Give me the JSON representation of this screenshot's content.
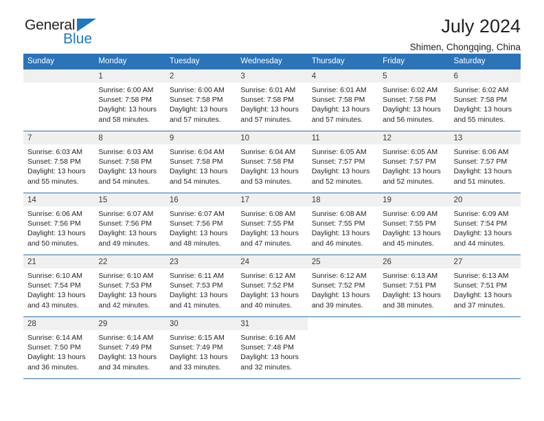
{
  "brand": {
    "name_part1": "General",
    "name_part2": "Blue",
    "triangle_color": "#1f78c1",
    "accent_color": "#2b74b8"
  },
  "header": {
    "title": "July 2024",
    "subtitle": "Shimen, Chongqing, China"
  },
  "weekday_headers": [
    "Sunday",
    "Monday",
    "Tuesday",
    "Wednesday",
    "Thursday",
    "Friday",
    "Saturday"
  ],
  "weeks": [
    [
      {
        "day": "",
        "lines": []
      },
      {
        "day": "1",
        "lines": [
          "Sunrise: 6:00 AM",
          "Sunset: 7:58 PM",
          "Daylight: 13 hours",
          "and 58 minutes."
        ]
      },
      {
        "day": "2",
        "lines": [
          "Sunrise: 6:00 AM",
          "Sunset: 7:58 PM",
          "Daylight: 13 hours",
          "and 57 minutes."
        ]
      },
      {
        "day": "3",
        "lines": [
          "Sunrise: 6:01 AM",
          "Sunset: 7:58 PM",
          "Daylight: 13 hours",
          "and 57 minutes."
        ]
      },
      {
        "day": "4",
        "lines": [
          "Sunrise: 6:01 AM",
          "Sunset: 7:58 PM",
          "Daylight: 13 hours",
          "and 57 minutes."
        ]
      },
      {
        "day": "5",
        "lines": [
          "Sunrise: 6:02 AM",
          "Sunset: 7:58 PM",
          "Daylight: 13 hours",
          "and 56 minutes."
        ]
      },
      {
        "day": "6",
        "lines": [
          "Sunrise: 6:02 AM",
          "Sunset: 7:58 PM",
          "Daylight: 13 hours",
          "and 55 minutes."
        ]
      }
    ],
    [
      {
        "day": "7",
        "lines": [
          "Sunrise: 6:03 AM",
          "Sunset: 7:58 PM",
          "Daylight: 13 hours",
          "and 55 minutes."
        ]
      },
      {
        "day": "8",
        "lines": [
          "Sunrise: 6:03 AM",
          "Sunset: 7:58 PM",
          "Daylight: 13 hours",
          "and 54 minutes."
        ]
      },
      {
        "day": "9",
        "lines": [
          "Sunrise: 6:04 AM",
          "Sunset: 7:58 PM",
          "Daylight: 13 hours",
          "and 54 minutes."
        ]
      },
      {
        "day": "10",
        "lines": [
          "Sunrise: 6:04 AM",
          "Sunset: 7:58 PM",
          "Daylight: 13 hours",
          "and 53 minutes."
        ]
      },
      {
        "day": "11",
        "lines": [
          "Sunrise: 6:05 AM",
          "Sunset: 7:57 PM",
          "Daylight: 13 hours",
          "and 52 minutes."
        ]
      },
      {
        "day": "12",
        "lines": [
          "Sunrise: 6:05 AM",
          "Sunset: 7:57 PM",
          "Daylight: 13 hours",
          "and 52 minutes."
        ]
      },
      {
        "day": "13",
        "lines": [
          "Sunrise: 6:06 AM",
          "Sunset: 7:57 PM",
          "Daylight: 13 hours",
          "and 51 minutes."
        ]
      }
    ],
    [
      {
        "day": "14",
        "lines": [
          "Sunrise: 6:06 AM",
          "Sunset: 7:56 PM",
          "Daylight: 13 hours",
          "and 50 minutes."
        ]
      },
      {
        "day": "15",
        "lines": [
          "Sunrise: 6:07 AM",
          "Sunset: 7:56 PM",
          "Daylight: 13 hours",
          "and 49 minutes."
        ]
      },
      {
        "day": "16",
        "lines": [
          "Sunrise: 6:07 AM",
          "Sunset: 7:56 PM",
          "Daylight: 13 hours",
          "and 48 minutes."
        ]
      },
      {
        "day": "17",
        "lines": [
          "Sunrise: 6:08 AM",
          "Sunset: 7:55 PM",
          "Daylight: 13 hours",
          "and 47 minutes."
        ]
      },
      {
        "day": "18",
        "lines": [
          "Sunrise: 6:08 AM",
          "Sunset: 7:55 PM",
          "Daylight: 13 hours",
          "and 46 minutes."
        ]
      },
      {
        "day": "19",
        "lines": [
          "Sunrise: 6:09 AM",
          "Sunset: 7:55 PM",
          "Daylight: 13 hours",
          "and 45 minutes."
        ]
      },
      {
        "day": "20",
        "lines": [
          "Sunrise: 6:09 AM",
          "Sunset: 7:54 PM",
          "Daylight: 13 hours",
          "and 44 minutes."
        ]
      }
    ],
    [
      {
        "day": "21",
        "lines": [
          "Sunrise: 6:10 AM",
          "Sunset: 7:54 PM",
          "Daylight: 13 hours",
          "and 43 minutes."
        ]
      },
      {
        "day": "22",
        "lines": [
          "Sunrise: 6:10 AM",
          "Sunset: 7:53 PM",
          "Daylight: 13 hours",
          "and 42 minutes."
        ]
      },
      {
        "day": "23",
        "lines": [
          "Sunrise: 6:11 AM",
          "Sunset: 7:53 PM",
          "Daylight: 13 hours",
          "and 41 minutes."
        ]
      },
      {
        "day": "24",
        "lines": [
          "Sunrise: 6:12 AM",
          "Sunset: 7:52 PM",
          "Daylight: 13 hours",
          "and 40 minutes."
        ]
      },
      {
        "day": "25",
        "lines": [
          "Sunrise: 6:12 AM",
          "Sunset: 7:52 PM",
          "Daylight: 13 hours",
          "and 39 minutes."
        ]
      },
      {
        "day": "26",
        "lines": [
          "Sunrise: 6:13 AM",
          "Sunset: 7:51 PM",
          "Daylight: 13 hours",
          "and 38 minutes."
        ]
      },
      {
        "day": "27",
        "lines": [
          "Sunrise: 6:13 AM",
          "Sunset: 7:51 PM",
          "Daylight: 13 hours",
          "and 37 minutes."
        ]
      }
    ],
    [
      {
        "day": "28",
        "lines": [
          "Sunrise: 6:14 AM",
          "Sunset: 7:50 PM",
          "Daylight: 13 hours",
          "and 36 minutes."
        ]
      },
      {
        "day": "29",
        "lines": [
          "Sunrise: 6:14 AM",
          "Sunset: 7:49 PM",
          "Daylight: 13 hours",
          "and 34 minutes."
        ]
      },
      {
        "day": "30",
        "lines": [
          "Sunrise: 6:15 AM",
          "Sunset: 7:49 PM",
          "Daylight: 13 hours",
          "and 33 minutes."
        ]
      },
      {
        "day": "31",
        "lines": [
          "Sunrise: 6:16 AM",
          "Sunset: 7:48 PM",
          "Daylight: 13 hours",
          "and 32 minutes."
        ]
      },
      {
        "day": "",
        "lines": []
      },
      {
        "day": "",
        "lines": []
      },
      {
        "day": "",
        "lines": []
      }
    ]
  ]
}
